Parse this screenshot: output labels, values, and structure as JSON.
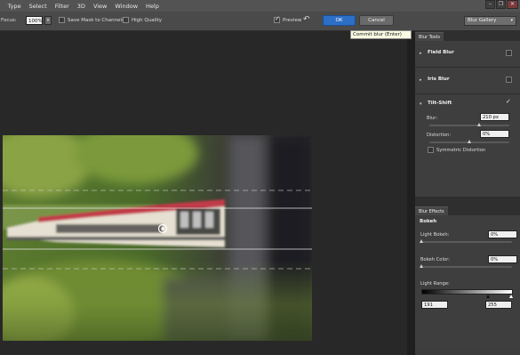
{
  "menu": [
    "r",
    "Type",
    "Select",
    "Filter",
    "3D",
    "View",
    "Window",
    "Help"
  ],
  "window_controls": [
    "–",
    "❐",
    "✕"
  ],
  "options": {
    "focus_label": "Focus:",
    "focus_value": "100%",
    "focus_dropdown": "▾",
    "save_mask_label": "Save Mask to Channels",
    "high_quality_label": "High Quality",
    "preview_label": "Preview",
    "undo_glyph": "↶",
    "ok_label": "OK",
    "cancel_label": "Cancel",
    "gallery_value": "Blur Gallery",
    "gallery_chevron": "▾"
  },
  "tooltip": "Commit blur (Enter)",
  "panel": {
    "blur_tools_tab": "Blur Tools",
    "field_blur": "Field Blur",
    "iris_blur": "Iris Blur",
    "tilt_shift": "Tilt-Shift",
    "blur_label": "Blur:",
    "blur_value": "210 px",
    "blur_level": 0.62,
    "distortion_label": "Distortion:",
    "distortion_value": "0%",
    "distortion_level": 0.5,
    "symmetric_label": "Symmetric Distortion",
    "blur_effects_tab": "Blur Effects",
    "bokeh": "Bokeh",
    "light_bokeh_label": "Light Bokeh:",
    "light_bokeh_value": "0%",
    "bokeh_color_label": "Bokeh Color:",
    "bokeh_color_value": "0%",
    "light_range_label": "Light Range:",
    "light_range_low": "191",
    "light_range_high": "255",
    "tri_collapsed": "▸",
    "tri_expanded": "▾"
  }
}
